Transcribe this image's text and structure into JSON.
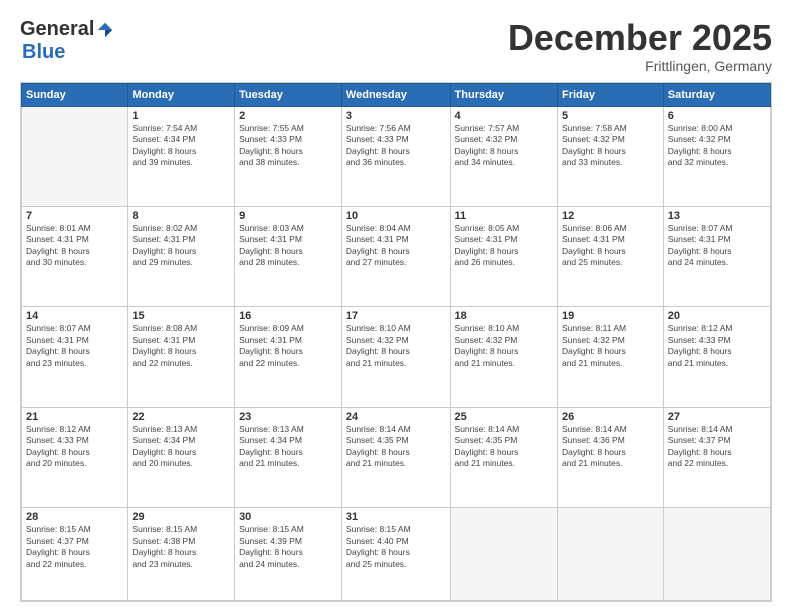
{
  "header": {
    "logo_general": "General",
    "logo_blue": "Blue",
    "month_title": "December 2025",
    "location": "Frittlingen, Germany"
  },
  "days": [
    "Sunday",
    "Monday",
    "Tuesday",
    "Wednesday",
    "Thursday",
    "Friday",
    "Saturday"
  ],
  "weeks": [
    [
      {
        "date": "",
        "sunrise": "",
        "sunset": "",
        "daylight": ""
      },
      {
        "date": "1",
        "sunrise": "Sunrise: 7:54 AM",
        "sunset": "Sunset: 4:34 PM",
        "daylight": "Daylight: 8 hours and 39 minutes."
      },
      {
        "date": "2",
        "sunrise": "Sunrise: 7:55 AM",
        "sunset": "Sunset: 4:33 PM",
        "daylight": "Daylight: 8 hours and 38 minutes."
      },
      {
        "date": "3",
        "sunrise": "Sunrise: 7:56 AM",
        "sunset": "Sunset: 4:33 PM",
        "daylight": "Daylight: 8 hours and 36 minutes."
      },
      {
        "date": "4",
        "sunrise": "Sunrise: 7:57 AM",
        "sunset": "Sunset: 4:32 PM",
        "daylight": "Daylight: 8 hours and 34 minutes."
      },
      {
        "date": "5",
        "sunrise": "Sunrise: 7:58 AM",
        "sunset": "Sunset: 4:32 PM",
        "daylight": "Daylight: 8 hours and 33 minutes."
      },
      {
        "date": "6",
        "sunrise": "Sunrise: 8:00 AM",
        "sunset": "Sunset: 4:32 PM",
        "daylight": "Daylight: 8 hours and 32 minutes."
      }
    ],
    [
      {
        "date": "7",
        "sunrise": "Sunrise: 8:01 AM",
        "sunset": "Sunset: 4:31 PM",
        "daylight": "Daylight: 8 hours and 30 minutes."
      },
      {
        "date": "8",
        "sunrise": "Sunrise: 8:02 AM",
        "sunset": "Sunset: 4:31 PM",
        "daylight": "Daylight: 8 hours and 29 minutes."
      },
      {
        "date": "9",
        "sunrise": "Sunrise: 8:03 AM",
        "sunset": "Sunset: 4:31 PM",
        "daylight": "Daylight: 8 hours and 28 minutes."
      },
      {
        "date": "10",
        "sunrise": "Sunrise: 8:04 AM",
        "sunset": "Sunset: 4:31 PM",
        "daylight": "Daylight: 8 hours and 27 minutes."
      },
      {
        "date": "11",
        "sunrise": "Sunrise: 8:05 AM",
        "sunset": "Sunset: 4:31 PM",
        "daylight": "Daylight: 8 hours and 26 minutes."
      },
      {
        "date": "12",
        "sunrise": "Sunrise: 8:06 AM",
        "sunset": "Sunset: 4:31 PM",
        "daylight": "Daylight: 8 hours and 25 minutes."
      },
      {
        "date": "13",
        "sunrise": "Sunrise: 8:07 AM",
        "sunset": "Sunset: 4:31 PM",
        "daylight": "Daylight: 8 hours and 24 minutes."
      }
    ],
    [
      {
        "date": "14",
        "sunrise": "Sunrise: 8:07 AM",
        "sunset": "Sunset: 4:31 PM",
        "daylight": "Daylight: 8 hours and 23 minutes."
      },
      {
        "date": "15",
        "sunrise": "Sunrise: 8:08 AM",
        "sunset": "Sunset: 4:31 PM",
        "daylight": "Daylight: 8 hours and 22 minutes."
      },
      {
        "date": "16",
        "sunrise": "Sunrise: 8:09 AM",
        "sunset": "Sunset: 4:31 PM",
        "daylight": "Daylight: 8 hours and 22 minutes."
      },
      {
        "date": "17",
        "sunrise": "Sunrise: 8:10 AM",
        "sunset": "Sunset: 4:32 PM",
        "daylight": "Daylight: 8 hours and 21 minutes."
      },
      {
        "date": "18",
        "sunrise": "Sunrise: 8:10 AM",
        "sunset": "Sunset: 4:32 PM",
        "daylight": "Daylight: 8 hours and 21 minutes."
      },
      {
        "date": "19",
        "sunrise": "Sunrise: 8:11 AM",
        "sunset": "Sunset: 4:32 PM",
        "daylight": "Daylight: 8 hours and 21 minutes."
      },
      {
        "date": "20",
        "sunrise": "Sunrise: 8:12 AM",
        "sunset": "Sunset: 4:33 PM",
        "daylight": "Daylight: 8 hours and 21 minutes."
      }
    ],
    [
      {
        "date": "21",
        "sunrise": "Sunrise: 8:12 AM",
        "sunset": "Sunset: 4:33 PM",
        "daylight": "Daylight: 8 hours and 20 minutes."
      },
      {
        "date": "22",
        "sunrise": "Sunrise: 8:13 AM",
        "sunset": "Sunset: 4:34 PM",
        "daylight": "Daylight: 8 hours and 20 minutes."
      },
      {
        "date": "23",
        "sunrise": "Sunrise: 8:13 AM",
        "sunset": "Sunset: 4:34 PM",
        "daylight": "Daylight: 8 hours and 21 minutes."
      },
      {
        "date": "24",
        "sunrise": "Sunrise: 8:14 AM",
        "sunset": "Sunset: 4:35 PM",
        "daylight": "Daylight: 8 hours and 21 minutes."
      },
      {
        "date": "25",
        "sunrise": "Sunrise: 8:14 AM",
        "sunset": "Sunset: 4:35 PM",
        "daylight": "Daylight: 8 hours and 21 minutes."
      },
      {
        "date": "26",
        "sunrise": "Sunrise: 8:14 AM",
        "sunset": "Sunset: 4:36 PM",
        "daylight": "Daylight: 8 hours and 21 minutes."
      },
      {
        "date": "27",
        "sunrise": "Sunrise: 8:14 AM",
        "sunset": "Sunset: 4:37 PM",
        "daylight": "Daylight: 8 hours and 22 minutes."
      }
    ],
    [
      {
        "date": "28",
        "sunrise": "Sunrise: 8:15 AM",
        "sunset": "Sunset: 4:37 PM",
        "daylight": "Daylight: 8 hours and 22 minutes."
      },
      {
        "date": "29",
        "sunrise": "Sunrise: 8:15 AM",
        "sunset": "Sunset: 4:38 PM",
        "daylight": "Daylight: 8 hours and 23 minutes."
      },
      {
        "date": "30",
        "sunrise": "Sunrise: 8:15 AM",
        "sunset": "Sunset: 4:39 PM",
        "daylight": "Daylight: 8 hours and 24 minutes."
      },
      {
        "date": "31",
        "sunrise": "Sunrise: 8:15 AM",
        "sunset": "Sunset: 4:40 PM",
        "daylight": "Daylight: 8 hours and 25 minutes."
      },
      {
        "date": "",
        "sunrise": "",
        "sunset": "",
        "daylight": ""
      },
      {
        "date": "",
        "sunrise": "",
        "sunset": "",
        "daylight": ""
      },
      {
        "date": "",
        "sunrise": "",
        "sunset": "",
        "daylight": ""
      }
    ]
  ]
}
